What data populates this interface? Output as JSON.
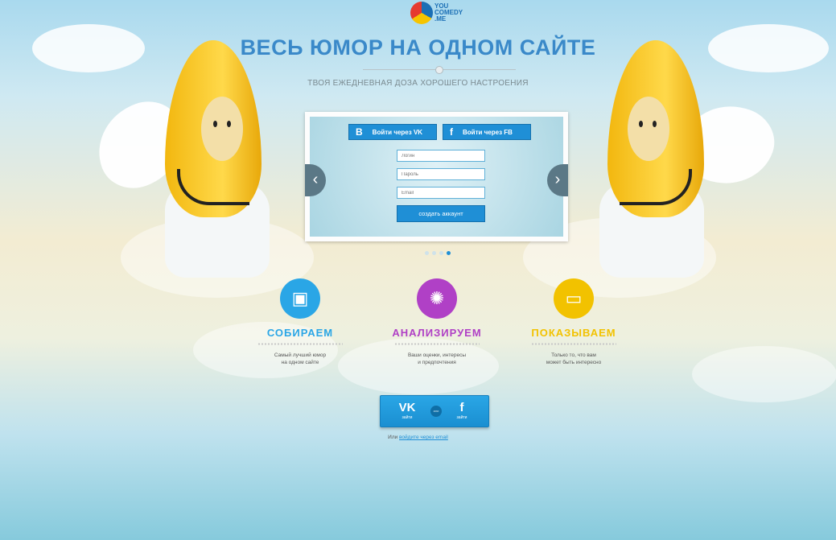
{
  "logo": {
    "line1": "YOU",
    "line2": "COMEDY",
    "line3": ".ME"
  },
  "header": {
    "title": "ВЕСЬ ЮМОР НА ОДНОМ САЙТЕ",
    "tagline": "ТВОЯ ЕЖЕДНЕВНАЯ ДОЗА ХОРОШЕГО НАСТРОЕНИЯ"
  },
  "slider": {
    "vk_button": "Войти через VK",
    "fb_button": "Войти через FB",
    "login_placeholder": "Логин",
    "password_placeholder": "Пароль",
    "email_placeholder": "Email",
    "create_button": "создать аккаунт",
    "prev": "‹",
    "next": "›",
    "active_slide": 4,
    "total_slides": 4
  },
  "features": [
    {
      "title": "СОБИРАЕМ",
      "line1": "Самый лучший юмор",
      "line2": "на одном сайте",
      "color": "#2aa6e6",
      "icon": "cube-icon"
    },
    {
      "title": "АНАЛИЗИРУЕМ",
      "line1": "Ваши оценки, интересы",
      "line2": "и предпочтения",
      "color": "#b040c6",
      "icon": "brain-icon"
    },
    {
      "title": "ПОКАЗЫВАЕМ",
      "line1": "Только то, что вам",
      "line2": "может быть интересно",
      "color": "#f2c200",
      "icon": "tv-icon"
    }
  ],
  "bottom_login": {
    "vk_glyph": "VK",
    "vk_label": "зайти",
    "or_badge": "или",
    "fb_glyph": "f",
    "fb_label": "зайти",
    "or_text": "Или ",
    "email_link": "войдите через email"
  }
}
